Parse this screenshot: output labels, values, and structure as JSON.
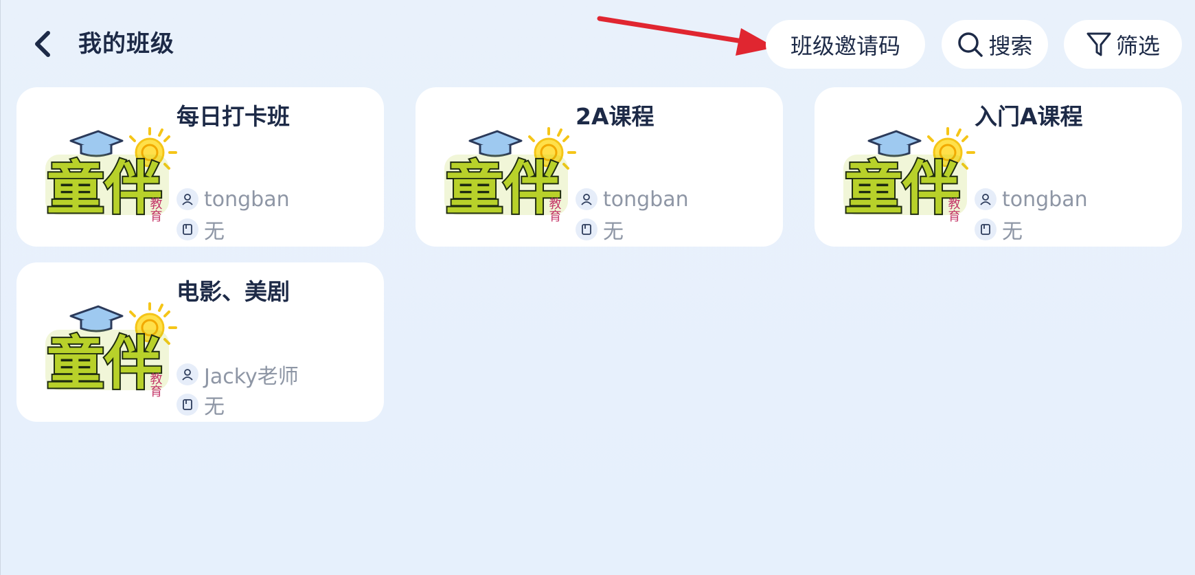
{
  "header": {
    "title": "我的班级",
    "invite_label": "班级邀请码",
    "search_label": "搜索",
    "filter_label": "筛选"
  },
  "logo": {
    "brand": "童伴",
    "sub": "教育"
  },
  "classes": [
    {
      "title": "每日打卡班",
      "teacher": "tongban",
      "book": "无"
    },
    {
      "title": "2A课程",
      "teacher": "tongban",
      "book": "无"
    },
    {
      "title": "入门A课程",
      "teacher": "tongban",
      "book": "无"
    },
    {
      "title": "电影、美剧",
      "teacher": "Jacky老师",
      "book": "无"
    }
  ],
  "colors": {
    "background": "#e8f1fc",
    "card": "#ffffff",
    "title_text": "#1d2a47",
    "meta_text": "#8e96a5",
    "annotation_arrow": "#e02630"
  }
}
